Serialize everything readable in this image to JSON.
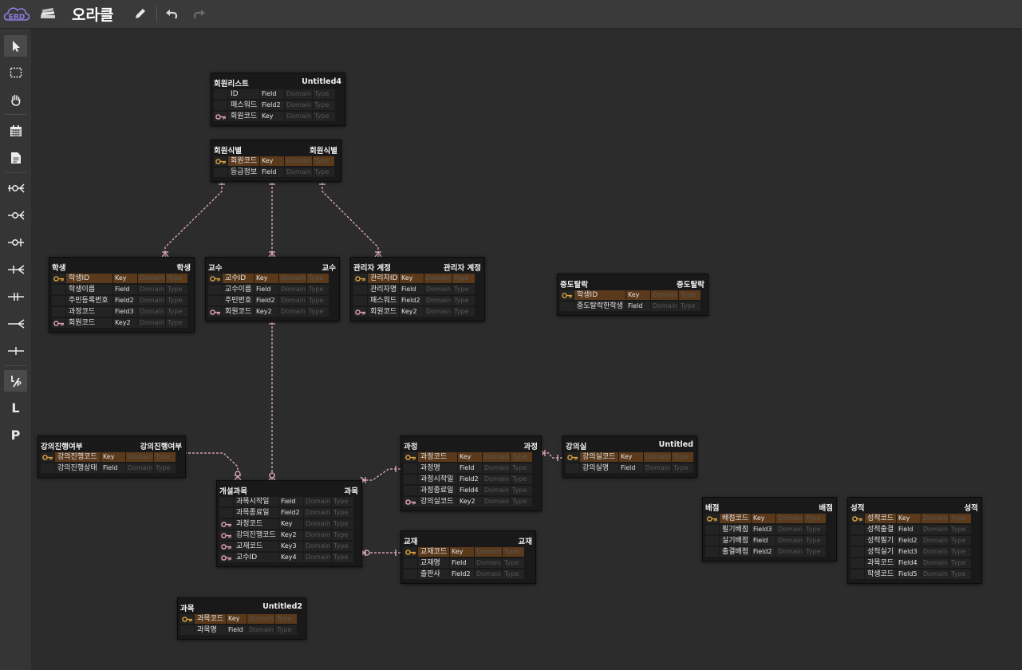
{
  "app": {
    "logo_text": "ERD",
    "title": "오라클"
  },
  "icons": {
    "topbar": [
      "cloud-erd-logo",
      "books-icon",
      "pencil-icon",
      "undo-icon",
      "redo-icon"
    ],
    "sidebar": [
      "pointer-icon",
      "selection-icon",
      "hand-icon",
      "table-icon",
      "memo-icon",
      "zero-one-n-icon",
      "zero-n-icon",
      "zero-one-icon",
      "one-n-icon",
      "one-one-icon",
      "n-icon",
      "one-icon",
      "identification-toggle-icon"
    ],
    "sidebar_letters": [
      "L",
      "P"
    ]
  },
  "colors": {
    "canvas": "#2c2c2c",
    "table": "#191919",
    "pk_row": "#5b3a1b",
    "pk_key": "#e2a43a",
    "fk_key": "#e7a3bc",
    "relation": "#f0b4c6"
  },
  "tables": [
    {
      "name": "회원리스트",
      "comment": "Untitled4",
      "columns": [
        {
          "key": "",
          "name": "ID",
          "type": "Field",
          "domain": "Domain",
          "ctype": "Type"
        },
        {
          "key": "",
          "name": "패스워드",
          "type": "Field2",
          "domain": "Domain",
          "ctype": "Type"
        },
        {
          "key": "fk",
          "name": "회원코드",
          "type": "Key",
          "domain": "Domain",
          "ctype": "Type"
        }
      ]
    },
    {
      "name": "회원식별",
      "comment": "회원식별",
      "columns": [
        {
          "key": "pk",
          "name": "회원코드",
          "type": "Key",
          "domain": "Domain",
          "ctype": "Type"
        },
        {
          "key": "",
          "name": "등급정보",
          "type": "Field",
          "domain": "Domain",
          "ctype": "Type"
        }
      ]
    },
    {
      "name": "학생",
      "comment": "학생",
      "columns": [
        {
          "key": "pk",
          "name": "학생ID",
          "type": "Key",
          "domain": "Domain",
          "ctype": "Type"
        },
        {
          "key": "",
          "name": "학생이름",
          "type": "Field",
          "domain": "Domain",
          "ctype": "Type"
        },
        {
          "key": "",
          "name": "주민등록번호",
          "type": "Field2",
          "domain": "Domain",
          "ctype": "Type"
        },
        {
          "key": "",
          "name": "과정코드",
          "type": "Field3",
          "domain": "Domain",
          "ctype": "Type"
        },
        {
          "key": "fk",
          "name": "회원코드",
          "type": "Key2",
          "domain": "Domain",
          "ctype": "Type"
        }
      ]
    },
    {
      "name": "교수",
      "comment": "교수",
      "columns": [
        {
          "key": "pk",
          "name": "교수ID",
          "type": "Key",
          "domain": "Domain",
          "ctype": "Type"
        },
        {
          "key": "",
          "name": "교수이름",
          "type": "Field",
          "domain": "Domain",
          "ctype": "Type"
        },
        {
          "key": "",
          "name": "주민번호",
          "type": "Field2",
          "domain": "Domain",
          "ctype": "Type"
        },
        {
          "key": "fk",
          "name": "회원코드",
          "type": "Key2",
          "domain": "Domain",
          "ctype": "Type"
        }
      ]
    },
    {
      "name": "관리자 계정",
      "comment": "관리자 계정",
      "columns": [
        {
          "key": "pk",
          "name": "관리자ID",
          "type": "Key",
          "domain": "Domain",
          "ctype": "Type"
        },
        {
          "key": "",
          "name": "관리자명",
          "type": "Field",
          "domain": "Domain",
          "ctype": "Type"
        },
        {
          "key": "",
          "name": "패스워드",
          "type": "Field2",
          "domain": "Domain",
          "ctype": "Type"
        },
        {
          "key": "fk",
          "name": "회원코드",
          "type": "Key2",
          "domain": "Domain",
          "ctype": "Type"
        }
      ]
    },
    {
      "name": "중도탈락",
      "comment": "중도탈락",
      "columns": [
        {
          "key": "pk",
          "name": "학생ID",
          "type": "Key",
          "domain": "Domain",
          "ctype": "Type"
        },
        {
          "key": "",
          "name": "중도탈락한학생",
          "type": "Field",
          "domain": "Domain",
          "ctype": "Type"
        }
      ]
    },
    {
      "name": "강의진행여부",
      "comment": "강의진행여부",
      "columns": [
        {
          "key": "pk",
          "name": "강의진행코드",
          "type": "Key",
          "domain": "Domain",
          "ctype": "Type"
        },
        {
          "key": "",
          "name": "강의진행상태",
          "type": "Field",
          "domain": "Domain",
          "ctype": "Type"
        }
      ]
    },
    {
      "name": "개설과목",
      "comment": "과목",
      "columns": [
        {
          "key": "",
          "name": "과목시작일",
          "type": "Field",
          "domain": "Domain",
          "ctype": "Type"
        },
        {
          "key": "",
          "name": "과목종료일",
          "type": "Field2",
          "domain": "Domain",
          "ctype": "Type"
        },
        {
          "key": "fk",
          "name": "과정코드",
          "type": "Key",
          "domain": "Domain",
          "ctype": "Type"
        },
        {
          "key": "fk",
          "name": "강의진행코드",
          "type": "Key2",
          "domain": "Domain",
          "ctype": "Type"
        },
        {
          "key": "fk",
          "name": "교재코드",
          "type": "Key3",
          "domain": "Domain",
          "ctype": "Type"
        },
        {
          "key": "fk",
          "name": "교수ID",
          "type": "Key4",
          "domain": "Domain",
          "ctype": "Type"
        }
      ]
    },
    {
      "name": "과정",
      "comment": "과정",
      "columns": [
        {
          "key": "pk",
          "name": "과정코드",
          "type": "Key",
          "domain": "Domain",
          "ctype": "Type"
        },
        {
          "key": "",
          "name": "과정명",
          "type": "Field",
          "domain": "Domain",
          "ctype": "Type"
        },
        {
          "key": "",
          "name": "과정시작일",
          "type": "Field2",
          "domain": "Domain",
          "ctype": "Type"
        },
        {
          "key": "",
          "name": "과정종료일",
          "type": "Field4",
          "domain": "Domain",
          "ctype": "Type"
        },
        {
          "key": "fk",
          "name": "강의실코드",
          "type": "Key2",
          "domain": "Domain",
          "ctype": "Type"
        }
      ]
    },
    {
      "name": "강의실",
      "comment": "Untitled",
      "columns": [
        {
          "key": "pk",
          "name": "강의실코드",
          "type": "Key",
          "domain": "Domain",
          "ctype": "Type"
        },
        {
          "key": "",
          "name": "강의실명",
          "type": "Field",
          "domain": "Domain",
          "ctype": "Type"
        }
      ]
    },
    {
      "name": "교재",
      "comment": "교재",
      "columns": [
        {
          "key": "pk",
          "name": "교재코드",
          "type": "Key",
          "domain": "Domain",
          "ctype": "Type"
        },
        {
          "key": "",
          "name": "교재명",
          "type": "Field",
          "domain": "Domain",
          "ctype": "Type"
        },
        {
          "key": "",
          "name": "출판사",
          "type": "Field2",
          "domain": "Domain",
          "ctype": "Type"
        }
      ]
    },
    {
      "name": "배점",
      "comment": "배점",
      "columns": [
        {
          "key": "pk",
          "name": "배점코드",
          "type": "Key",
          "domain": "Domain",
          "ctype": "Type"
        },
        {
          "key": "",
          "name": "필기배점",
          "type": "Field3",
          "domain": "Domain",
          "ctype": "Type"
        },
        {
          "key": "",
          "name": "실기배점",
          "type": "Field",
          "domain": "Domain",
          "ctype": "Type"
        },
        {
          "key": "",
          "name": "출결배점",
          "type": "Field2",
          "domain": "Domain",
          "ctype": "Type"
        }
      ]
    },
    {
      "name": "성적",
      "comment": "성적",
      "columns": [
        {
          "key": "pk",
          "name": "성적코드",
          "type": "Key",
          "domain": "Domain",
          "ctype": "Type"
        },
        {
          "key": "",
          "name": "성적출결",
          "type": "Field",
          "domain": "Domain",
          "ctype": "Type"
        },
        {
          "key": "",
          "name": "성적필기",
          "type": "Field2",
          "domain": "Domain",
          "ctype": "Type"
        },
        {
          "key": "",
          "name": "성적실기",
          "type": "Field3",
          "domain": "Domain",
          "ctype": "Type"
        },
        {
          "key": "",
          "name": "과목코드",
          "type": "Field4",
          "domain": "Domain",
          "ctype": "Type"
        },
        {
          "key": "",
          "name": "학생코드",
          "type": "Field5",
          "domain": "Domain",
          "ctype": "Type"
        }
      ]
    },
    {
      "name": "과목",
      "comment": "Untitled2",
      "columns": [
        {
          "key": "pk",
          "name": "과목코드",
          "type": "Key",
          "domain": "Domain",
          "ctype": "Type"
        },
        {
          "key": "",
          "name": "과목명",
          "type": "Field",
          "domain": "Domain",
          "ctype": "Type"
        }
      ]
    }
  ],
  "relations": [
    {
      "from": "회원식별",
      "to": "학생"
    },
    {
      "from": "회원식별",
      "to": "교수"
    },
    {
      "from": "회원식별",
      "to": "관리자 계정"
    },
    {
      "from": "교수",
      "to": "개설과목"
    },
    {
      "from": "강의진행여부",
      "to": "개설과목"
    },
    {
      "from": "과정",
      "to": "개설과목"
    },
    {
      "from": "교재",
      "to": "개설과목"
    },
    {
      "from": "강의실",
      "to": "과정"
    }
  ]
}
